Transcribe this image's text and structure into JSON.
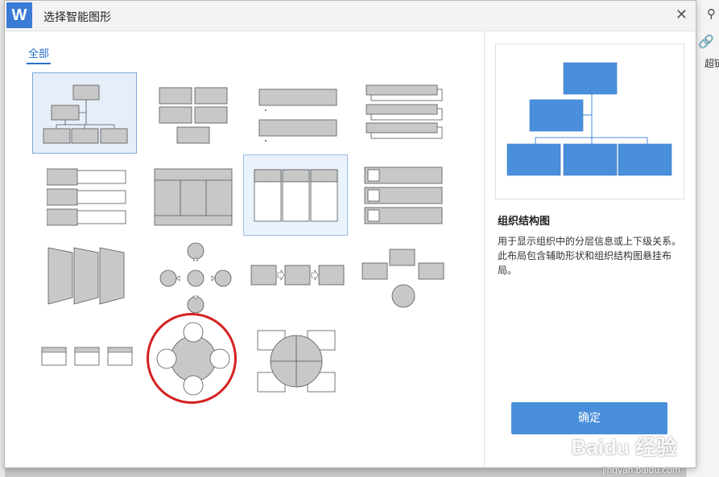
{
  "dialog": {
    "title": "选择智能图形",
    "app_icon": "wps-writer-icon",
    "close_icon": "close-icon"
  },
  "tabs": [
    {
      "label": "全部",
      "active": true
    }
  ],
  "preview": {
    "layout_name": "组织结构图",
    "description": "用于显示组织中的分层信息或上下级关系。此布局包含辅助形状和组织结构图悬挂布局。"
  },
  "actions": {
    "ok_label": "确定"
  },
  "background_app": {
    "label": "超链"
  },
  "watermark": {
    "text": "Baidu 经验",
    "sub": "jingyan.baidu.com"
  },
  "colors": {
    "accent": "#2a6fc9",
    "preview_box": "#4a8fdc",
    "thumb_box": "#c8c8c8",
    "highlight": "#d42020"
  }
}
